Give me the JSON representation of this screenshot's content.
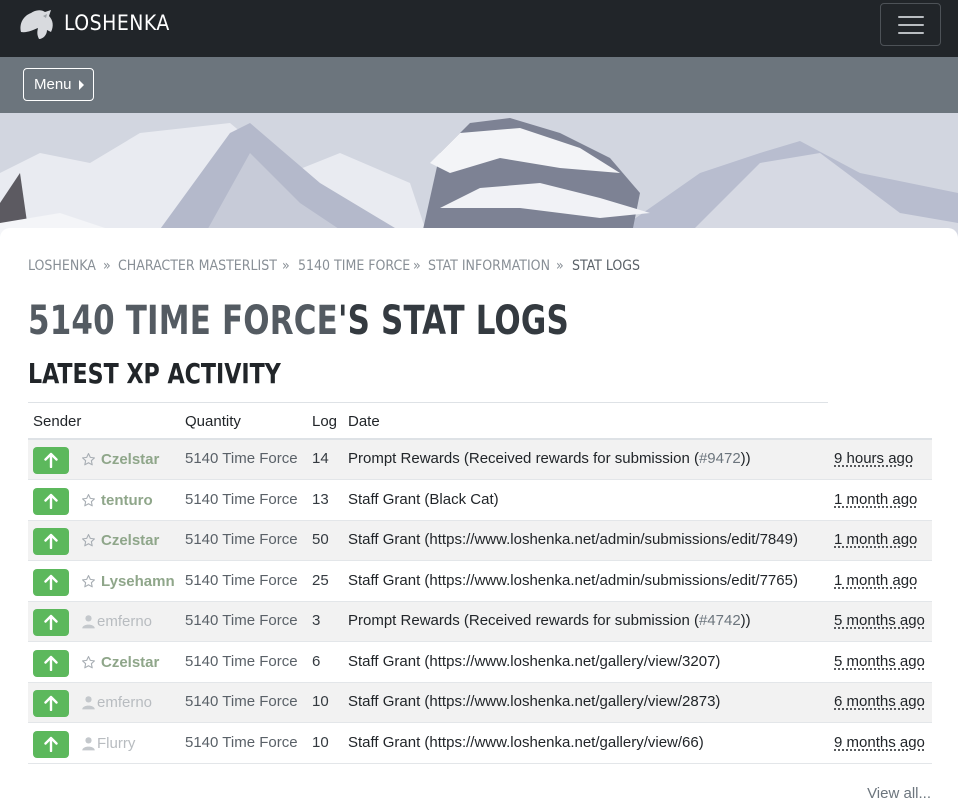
{
  "nav": {
    "brand": "LOSHENKA"
  },
  "menu": {
    "label": "Menu"
  },
  "breadcrumb": [
    {
      "label": "LOSHENKA"
    },
    {
      "label": "CHARACTER MASTERLIST"
    },
    {
      "label": "5140 TIME FORCE"
    },
    {
      "label": "STAT INFORMATION"
    },
    {
      "label": "STAT LOGS"
    }
  ],
  "breadcrumb_separator": "»",
  "page": {
    "title_character": "5140 TIME FORCE",
    "title_suffix": "'S STAT LOGS",
    "section": "LATEST XP ACTIVITY"
  },
  "table": {
    "headers": [
      "Sender",
      "Quantity",
      "Log",
      "Date"
    ],
    "rows": [
      {
        "sender": "Czelstar",
        "sender_icon": "star-icon",
        "recipient": "5140 Time Force",
        "quantity": "14",
        "log_text": "Prompt Rewards (Received rewards for submission (",
        "log_ref": "#9472",
        "log_end": "))",
        "date": "9 hours ago"
      },
      {
        "sender": "tenturo",
        "sender_icon": "star-icon",
        "recipient": "5140 Time Force",
        "quantity": "13",
        "log_text": "Staff Grant (Black Cat)",
        "log_ref": "",
        "log_end": "",
        "date": "1 month ago"
      },
      {
        "sender": "Czelstar",
        "sender_icon": "star-icon",
        "recipient": "5140 Time Force",
        "quantity": "50",
        "log_text": "Staff Grant (https://www.loshenka.net/admin/submissions/edit/7849)",
        "log_ref": "",
        "log_end": "",
        "date": "1 month ago"
      },
      {
        "sender": "Lysehamn",
        "sender_icon": "star-icon",
        "recipient": "5140 Time Force",
        "quantity": "25",
        "log_text": "Staff Grant (https://www.loshenka.net/admin/submissions/edit/7765)",
        "log_ref": "",
        "log_end": "",
        "date": "1 month ago"
      },
      {
        "sender": "emferno",
        "sender_icon": "user-icon",
        "recipient": "5140 Time Force",
        "quantity": "3",
        "log_text": "Prompt Rewards (Received rewards for submission (",
        "log_ref": "#4742",
        "log_end": "))",
        "date": "5 months ago"
      },
      {
        "sender": "Czelstar",
        "sender_icon": "star-icon",
        "recipient": "5140 Time Force",
        "quantity": "6",
        "log_text": "Staff Grant (https://www.loshenka.net/gallery/view/3207)",
        "log_ref": "",
        "log_end": "",
        "date": "5 months ago"
      },
      {
        "sender": "emferno",
        "sender_icon": "user-icon",
        "recipient": "5140 Time Force",
        "quantity": "10",
        "log_text": "Staff Grant (https://www.loshenka.net/gallery/view/2873)",
        "log_ref": "",
        "log_end": "",
        "date": "6 months ago"
      },
      {
        "sender": "Flurry",
        "sender_icon": "user-icon",
        "recipient": "5140 Time Force",
        "quantity": "10",
        "log_text": "Staff Grant (https://www.loshenka.net/gallery/view/66)",
        "log_ref": "",
        "log_end": "",
        "date": "9 months ago"
      }
    ]
  },
  "footer": {
    "view_all": "View all..."
  },
  "colors": {
    "navbar": "#212529",
    "menubar": "#6c757d",
    "credit_button": "#5cb85c",
    "staff_name": "#8fa68a"
  }
}
